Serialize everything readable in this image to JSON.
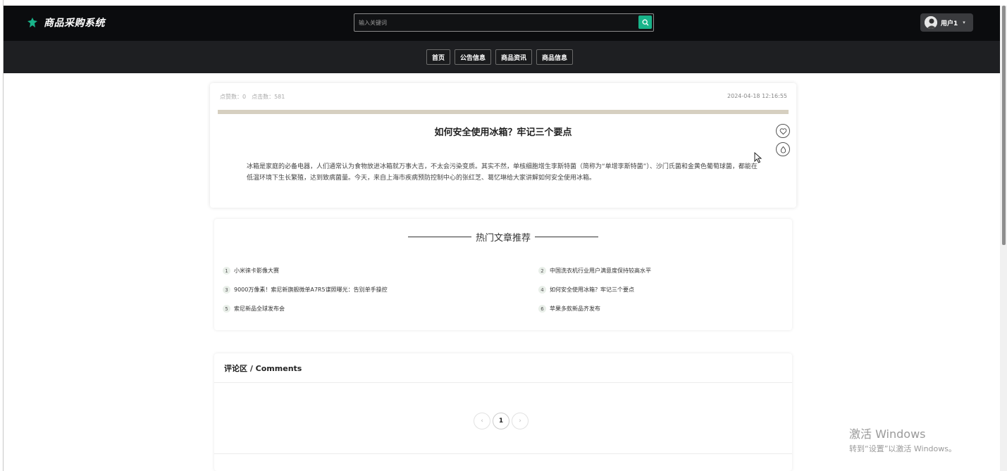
{
  "header": {
    "app_title": "商品采购系统",
    "search": {
      "placeholder": "输入关键词"
    },
    "user": {
      "name": "用户1"
    }
  },
  "nav": {
    "items": [
      {
        "label": "首页"
      },
      {
        "label": "公告信息"
      },
      {
        "label": "商品资讯"
      },
      {
        "label": "商品信息"
      }
    ]
  },
  "article": {
    "likes_label": "点赞数：0",
    "clicks_label": "点击数：581",
    "datetime": "2024-04-18 12:16:55",
    "title": "如何安全使用冰箱？牢记三个要点",
    "body": "冰箱是家庭的必备电器，人们通常认为食物放进冰箱就万事大吉，不太会污染变质。其实不然，单核细胞增生李斯特菌（简称为“单增李斯特菌”）、沙门氏菌和金黄色葡萄球菌，都能在低温环境下生长繁殖，达到致病菌量。今天，来自上海市疾病预防控制中心的张红芝、葛忆琳给大家讲解如何安全使用冰箱。",
    "actions": [
      {
        "icon": "heart-icon"
      },
      {
        "icon": "like-icon"
      }
    ]
  },
  "hot": {
    "title": "热门文章推荐",
    "items": [
      {
        "num": "1",
        "title": "小米徕卡影像大赛"
      },
      {
        "num": "2",
        "title": "中国洗衣机行业用户满意度保持较高水平"
      },
      {
        "num": "3",
        "title": "9000万像素！索尼新旗舰微单A7R5谍照曝光：告别单手操控"
      },
      {
        "num": "4",
        "title": "如何安全使用冰箱？牢记三个要点"
      },
      {
        "num": "5",
        "title": "索尼新品全球发布会"
      },
      {
        "num": "6",
        "title": "苹果多款新品齐发布"
      }
    ]
  },
  "comments": {
    "title": "评论区 / Comments",
    "pager": {
      "prev": "‹",
      "current": "1",
      "next": "›"
    }
  },
  "watermark": {
    "line1": "激活 Windows",
    "line2": "转到“设置”以激活 Windows。"
  },
  "colors": {
    "header_bg": "#0b0c0e",
    "nav_bg": "#1e1f22",
    "accent": "#19b48a",
    "article_bar": "#d6cfc0"
  }
}
